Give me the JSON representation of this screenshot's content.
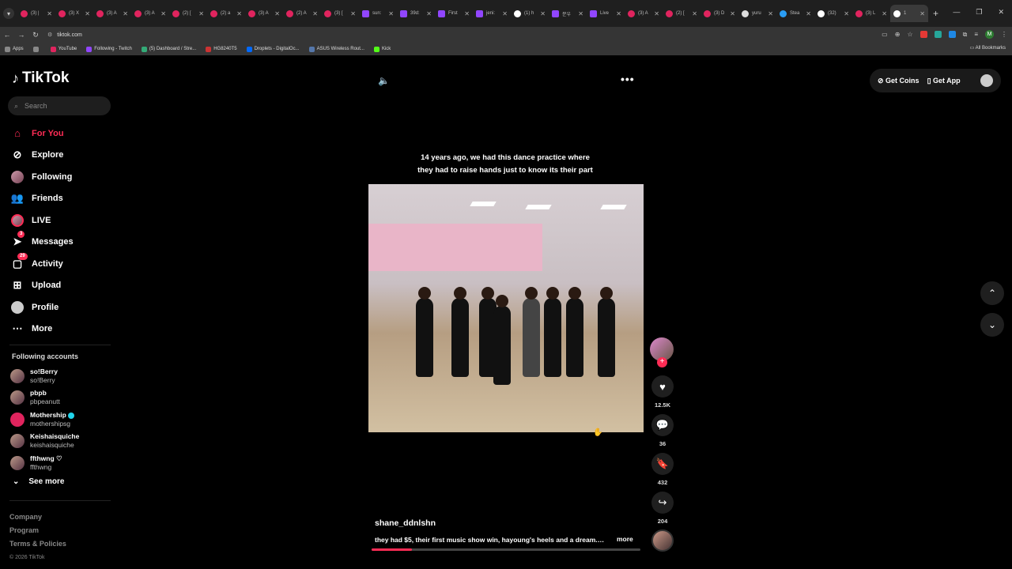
{
  "browser": {
    "tabs": [
      {
        "label": "(3) |",
        "type": "yt"
      },
      {
        "label": "(3) X",
        "type": "yt"
      },
      {
        "label": "(3) A",
        "type": "yt"
      },
      {
        "label": "(3) A",
        "type": "yt"
      },
      {
        "label": "(2) [",
        "type": "yt"
      },
      {
        "label": "(2) a",
        "type": "yt"
      },
      {
        "label": "(3) A",
        "type": "yt"
      },
      {
        "label": "(2) A",
        "type": "yt"
      },
      {
        "label": "(3) [",
        "type": "yt"
      },
      {
        "label": "sun:",
        "type": "tw"
      },
      {
        "label": "39d:",
        "type": "tw"
      },
      {
        "label": "First",
        "type": "tw"
      },
      {
        "label": "jeni:",
        "type": "tw"
      },
      {
        "label": "(1) h",
        "type": "x"
      },
      {
        "label": "문우",
        "type": "tw"
      },
      {
        "label": "Live",
        "type": "tw"
      },
      {
        "label": "(3) A",
        "type": "yt"
      },
      {
        "label": "(2) [",
        "type": "yt"
      },
      {
        "label": "(3) D",
        "type": "yt"
      },
      {
        "label": "yuru",
        "type": "g"
      },
      {
        "label": "Stea",
        "type": "s"
      },
      {
        "label": "(32)",
        "type": "x"
      },
      {
        "label": "(3) L",
        "type": "yt"
      },
      {
        "label": "1",
        "type": "x",
        "active": true
      }
    ],
    "url": "tiktok.com",
    "bookmarks": [
      {
        "label": "Apps",
        "color": "#888"
      },
      {
        "label": "",
        "color": "#888"
      },
      {
        "label": "YouTube",
        "color": "#e0245e"
      },
      {
        "label": "Following - Twitch",
        "color": "#9146ff"
      },
      {
        "label": "(5) Dashboard / Stre...",
        "color": "#3a7"
      },
      {
        "label": "HG8240T5",
        "color": "#c33"
      },
      {
        "label": "Droplets - DigitalOc...",
        "color": "#0069ff"
      },
      {
        "label": "ASUS Wireless Rout...",
        "color": "#57a"
      },
      {
        "label": "Kick",
        "color": "#53fc18"
      }
    ],
    "all_bookmarks": "All Bookmarks"
  },
  "sidebar": {
    "logo": "TikTok",
    "search_placeholder": "Search",
    "nav": [
      {
        "label": "For You",
        "icon": "home-icon",
        "glyph": "⌂",
        "active": true
      },
      {
        "label": "Explore",
        "icon": "compass-icon",
        "glyph": "⊘"
      },
      {
        "label": "Following",
        "icon": "following-avatar",
        "glyph": ""
      },
      {
        "label": "Friends",
        "icon": "friends-icon",
        "glyph": "👥"
      },
      {
        "label": "LIVE",
        "icon": "live-avatar",
        "glyph": ""
      },
      {
        "label": "Messages",
        "icon": "send-icon",
        "glyph": "➤",
        "badge": "3"
      },
      {
        "label": "Activity",
        "icon": "activity-icon",
        "glyph": "▢",
        "badge": "29"
      },
      {
        "label": "Upload",
        "icon": "upload-icon",
        "glyph": "⊞"
      },
      {
        "label": "Profile",
        "icon": "profile-avatar",
        "glyph": ""
      },
      {
        "label": "More",
        "icon": "more-icon",
        "glyph": "⋯"
      }
    ],
    "following_title": "Following accounts",
    "following": [
      {
        "name": "so!Berry",
        "handle": "so!Berry"
      },
      {
        "name": "pbpb",
        "handle": "pbpeanutt"
      },
      {
        "name": "Mothership",
        "handle": "mothershipsg",
        "verified": true
      },
      {
        "name": "Keishaisquiche",
        "handle": "keishaisquiche"
      },
      {
        "name": "ffthwng ♡",
        "handle": "ffthwng"
      }
    ],
    "see_more": "See more",
    "footer": [
      "Company",
      "Program",
      "Terms & Policies"
    ],
    "copyright": "© 2026 TikTok"
  },
  "header": {
    "get_coins": "Get Coins",
    "get_app": "Get App"
  },
  "video": {
    "caption": "14 years ago, we had this dance practice where they had to raise hands just to know its their part",
    "author": "shane_ddnlshn",
    "description": "they had $5, their first music show win, hayoung's heels and a dream.…",
    "more": "more",
    "progress": 0.15
  },
  "actions": {
    "likes": "12.5K",
    "comments": "36",
    "saves": "432",
    "shares": "204"
  }
}
